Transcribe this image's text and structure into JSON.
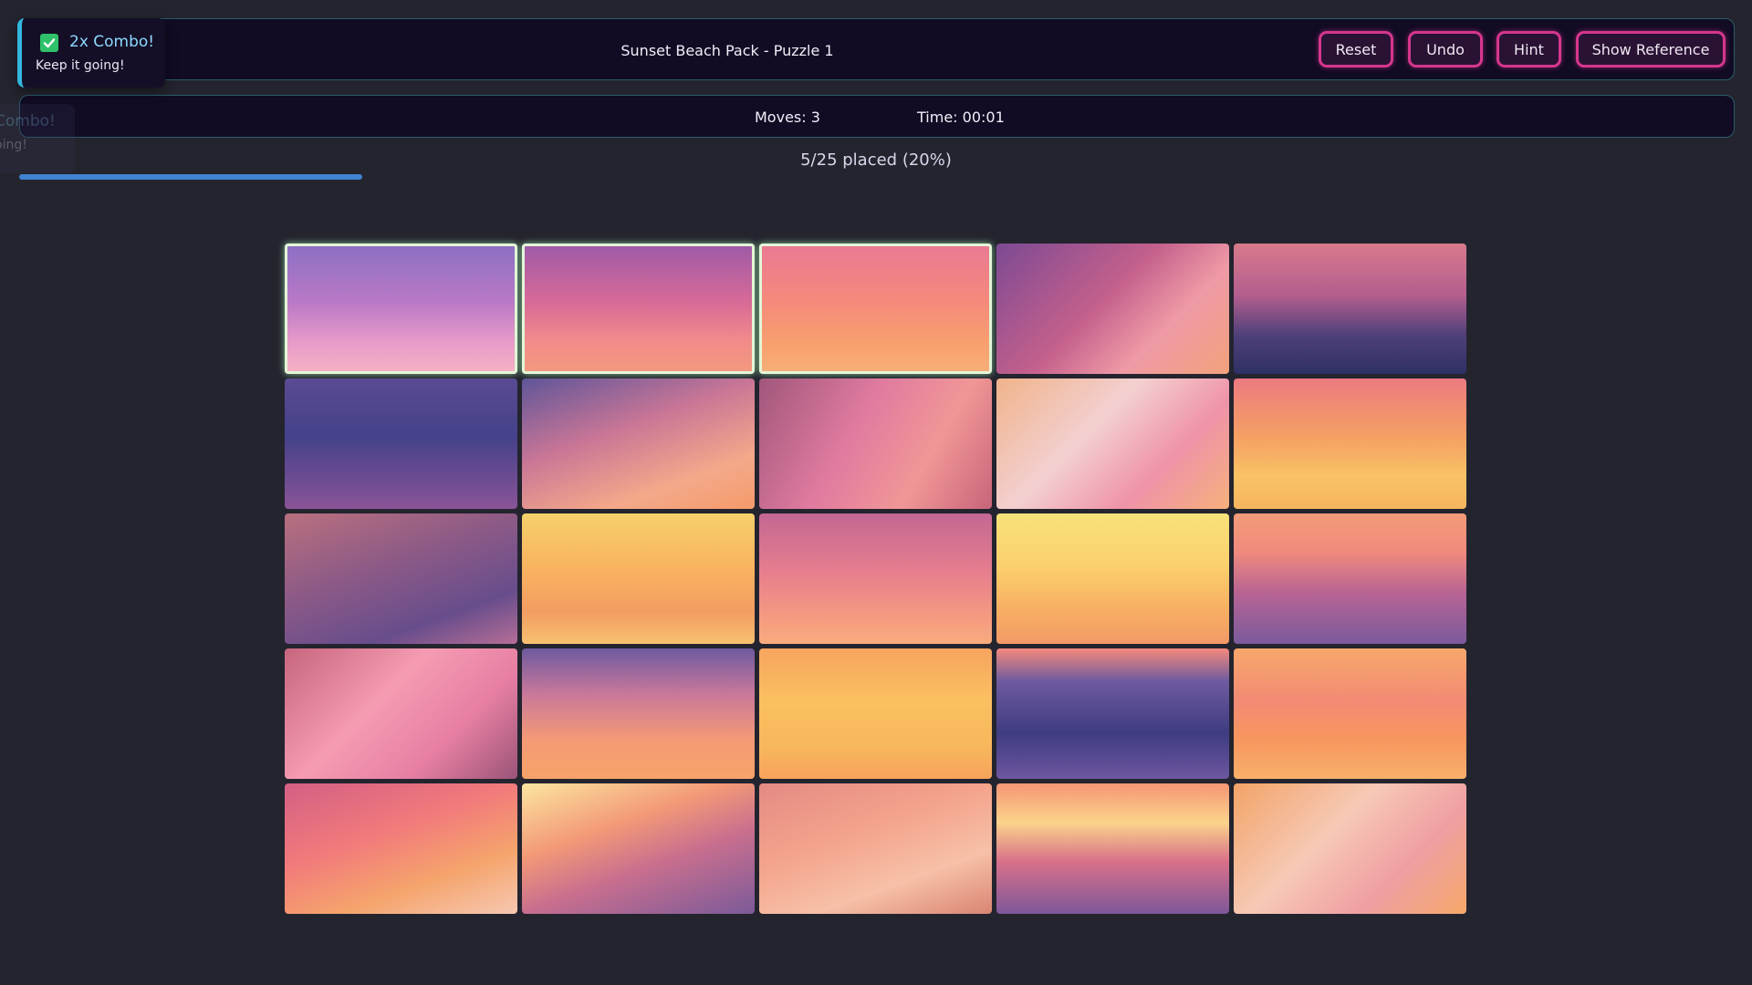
{
  "header": {
    "title": "Sunset Beach Pack - Puzzle 1",
    "buttons": {
      "reset": "Reset",
      "undo": "Undo",
      "hint": "Hint",
      "reference": "Show Reference"
    }
  },
  "stats": {
    "moves": "Moves: 3",
    "time": "Time: 00:01"
  },
  "progress": {
    "text": "5/25 placed (20%)",
    "placed": 5,
    "total": 25,
    "fraction": 0.2
  },
  "toast": {
    "title": "2x Combo!",
    "subtitle": "Keep it going!",
    "icon": "check-icon"
  },
  "toast_previous": {
    "title": "Combo!",
    "subtitle": "oing!"
  },
  "colors": {
    "accent_button_border": "#d6368e",
    "panel_bg": "#120b24",
    "panel_border": "#2a5d6a",
    "progress": "#3f83d3",
    "toast_accent": "#33b6de",
    "placed_outline": "#e3f6d8"
  },
  "board": {
    "rows": 5,
    "cols": 5,
    "tiles": [
      {
        "theme": "purple-clouds",
        "placed": true
      },
      {
        "theme": "pink-clouds",
        "placed": true
      },
      {
        "theme": "orange-clouds",
        "placed": true
      },
      {
        "theme": "sky-hair",
        "placed": false
      },
      {
        "theme": "waves-glow",
        "placed": false
      },
      {
        "theme": "ocean",
        "placed": false
      },
      {
        "theme": "shore-sandals",
        "placed": false
      },
      {
        "theme": "figure-hair",
        "placed": false
      },
      {
        "theme": "hair-wind",
        "placed": false
      },
      {
        "theme": "golden-clouds",
        "placed": false
      },
      {
        "theme": "figure-shore",
        "placed": false
      },
      {
        "theme": "golden-sky",
        "placed": false
      },
      {
        "theme": "pink-sky",
        "placed": false
      },
      {
        "theme": "sun-clouds",
        "placed": false
      },
      {
        "theme": "sea-horizon",
        "placed": false
      },
      {
        "theme": "hair-figure",
        "placed": false
      },
      {
        "theme": "beach-foam",
        "placed": false
      },
      {
        "theme": "bird-sky",
        "placed": false
      },
      {
        "theme": "sea-dark",
        "placed": false
      },
      {
        "theme": "orange-bird",
        "placed": false
      },
      {
        "theme": "sky-face",
        "placed": false
      },
      {
        "theme": "wave-sun",
        "placed": false
      },
      {
        "theme": "figure-beach",
        "placed": false
      },
      {
        "theme": "sunset-sea",
        "placed": false
      },
      {
        "theme": "figure-right",
        "placed": false
      }
    ]
  }
}
